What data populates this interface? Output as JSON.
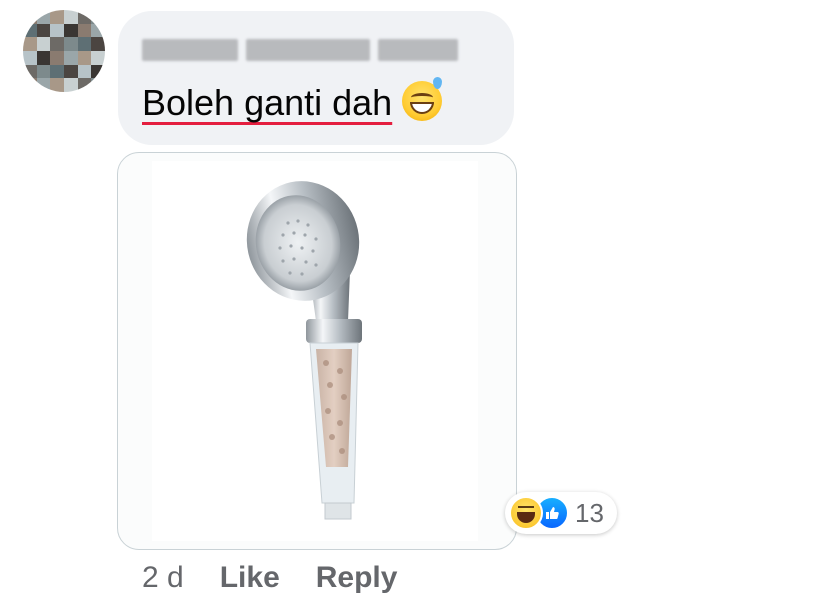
{
  "comment": {
    "text": "Boleh ganti dah",
    "emoji": "grinning-face-with-sweat-emoji",
    "spellcheck_underline_color": "#e41e3f",
    "author_obscured": true
  },
  "reactions": {
    "types": [
      "haha-reaction-icon",
      "like-reaction-icon"
    ],
    "count": "13"
  },
  "actions": {
    "timestamp": "2 d",
    "like_label": "Like",
    "reply_label": "Reply"
  },
  "colors": {
    "bubble_bg": "#f0f2f5",
    "meta_text": "#65676b",
    "like_blue": "#0866ff",
    "haha_yellow": "#fcc933"
  }
}
